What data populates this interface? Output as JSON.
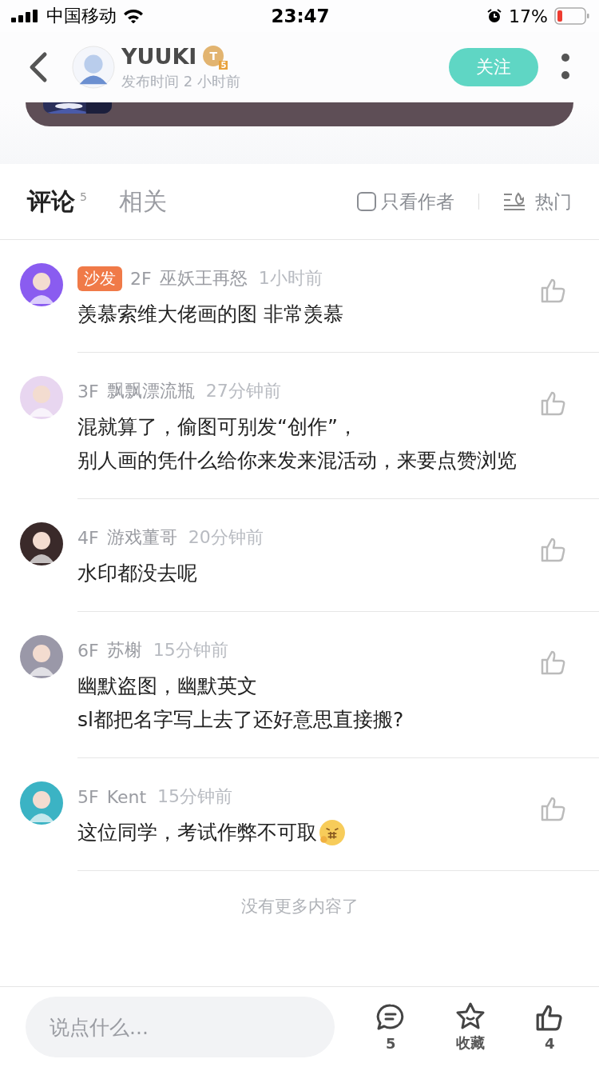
{
  "status_bar": {
    "carrier": "中国移动",
    "time": "23:47",
    "battery": "17%"
  },
  "header": {
    "author": "YUUKI",
    "level_badge": "T",
    "level_number": "5",
    "posted": "发布时间 2 小时前",
    "follow": "关注"
  },
  "tabs": [
    {
      "label": "评论",
      "count": "5",
      "selected": true
    },
    {
      "label": "相关",
      "selected": false
    }
  ],
  "filters": {
    "author_only": {
      "label": "只看作者",
      "checked": false
    },
    "sort": "热门"
  },
  "comments": [
    {
      "badge": "沙发",
      "floor": "2F",
      "user": "巫妖王再怒",
      "time": "1小时前",
      "lines": [
        "羡慕索维大佬画的图 非常羡慕"
      ],
      "emoji": false
    },
    {
      "floor": "3F",
      "user": "飘飘漂流瓶",
      "time": "27分钟前",
      "lines": [
        "混就算了，偷图可别发“创作”，",
        "别人画的凭什么给你来发来混活动，来要点赞浏览"
      ],
      "emoji": false
    },
    {
      "floor": "4F",
      "user": "游戏董哥",
      "time": "20分钟前",
      "lines": [
        "水印都没去呢"
      ],
      "emoji": false
    },
    {
      "floor": "6F",
      "user": "苏榭",
      "time": "15分钟前",
      "lines": [
        "幽默盗图，幽默英文",
        "sl都把名字写上去了还好意思直接搬?"
      ],
      "emoji": false
    },
    {
      "floor": "5F",
      "user": "Kent",
      "time": "15分钟前",
      "lines": [
        "这位同学，考试作弊不可取"
      ],
      "emoji": true
    }
  ],
  "end_note": "没有更多内容了",
  "bottom_bar": {
    "placeholder": "说点什么...",
    "comments": "5",
    "favorite": "收藏",
    "likes": "4"
  }
}
